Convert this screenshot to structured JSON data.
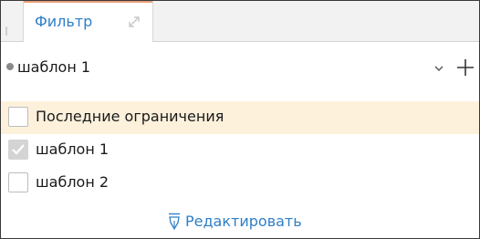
{
  "tab": {
    "label": "Фильтр",
    "expand_icon": "expand-diagonal-icon",
    "accent_color": "#e8a07d",
    "text_color": "#2f7fc8"
  },
  "template_selector": {
    "selected": "шаблон 1",
    "dropdown_icon": "chevron-down-icon",
    "add_icon": "plus-icon"
  },
  "list": {
    "items": [
      {
        "label": "Последние ограничения",
        "checked": false,
        "highlighted": true
      },
      {
        "label": "шаблон 1",
        "checked": true,
        "highlighted": false
      },
      {
        "label": "шаблон 2",
        "checked": false,
        "highlighted": false
      }
    ],
    "highlight_color": "#fdf1dc"
  },
  "footer": {
    "edit_label": "Редактировать",
    "edit_icon": "pen-nib-icon",
    "link_color": "#2f7fc8"
  }
}
